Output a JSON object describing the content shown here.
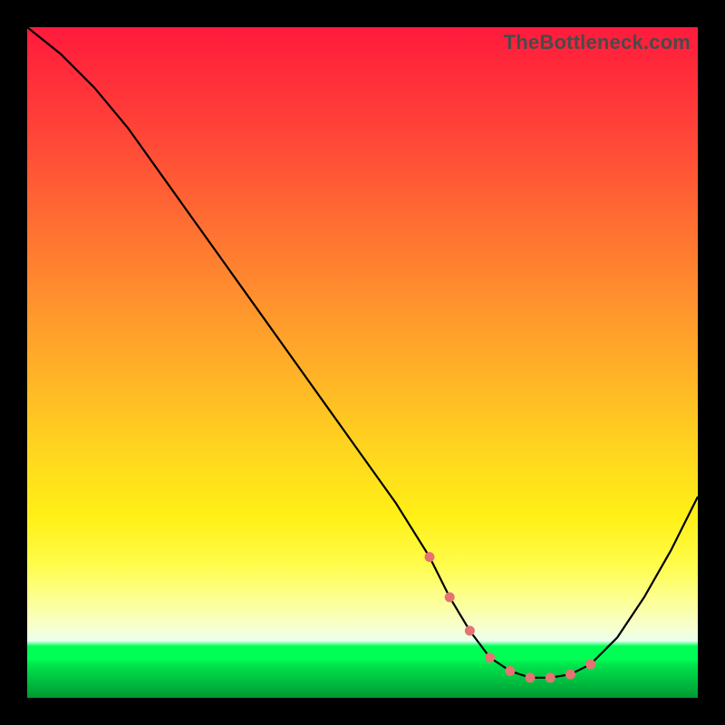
{
  "watermark": "TheBottleneck.com",
  "colors": {
    "background": "#000000",
    "curve": "#000000",
    "markers": "#e57373",
    "gradient_top": "#ff1a3c",
    "gradient_mid": "#fff016",
    "gradient_green": "#00ff55"
  },
  "chart_data": {
    "type": "line",
    "title": "",
    "xlabel": "",
    "ylabel": "",
    "xlim": [
      0,
      100
    ],
    "ylim": [
      0,
      100
    ],
    "grid": false,
    "series": [
      {
        "name": "bottleneck-curve",
        "x": [
          0,
          5,
          10,
          15,
          20,
          25,
          30,
          35,
          40,
          45,
          50,
          55,
          60,
          63,
          66,
          69,
          72,
          75,
          78,
          81,
          84,
          88,
          92,
          96,
          100
        ],
        "values": [
          100,
          96,
          91,
          85,
          78,
          71,
          64,
          57,
          50,
          43,
          36,
          29,
          21,
          15,
          10,
          6,
          4,
          3,
          3,
          3.5,
          5,
          9,
          15,
          22,
          30
        ]
      }
    ],
    "markers": {
      "name": "highlight-points",
      "x": [
        60,
        63,
        66,
        69,
        72,
        75,
        78,
        81,
        84
      ],
      "values": [
        21,
        15,
        10,
        6,
        4,
        3,
        3,
        3.5,
        5
      ]
    },
    "annotations": []
  }
}
